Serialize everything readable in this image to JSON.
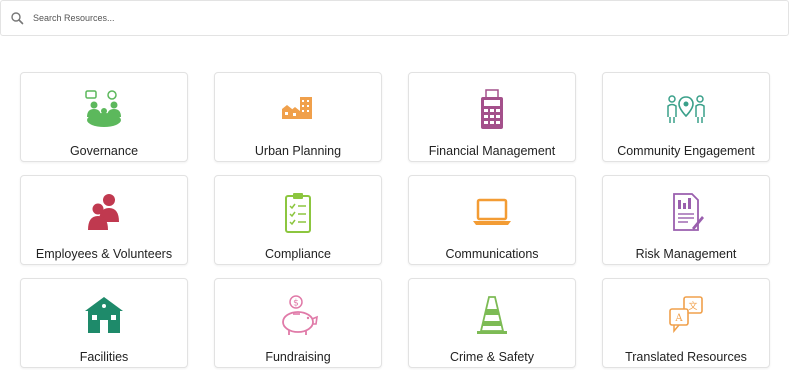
{
  "search": {
    "placeholder": "Search Resources..."
  },
  "cards": [
    {
      "label": "Governance",
      "icon": "meeting-icon",
      "color": "#5cb85c"
    },
    {
      "label": "Urban Planning",
      "icon": "city-icon",
      "color": "#f0a04b"
    },
    {
      "label": "Financial Management",
      "icon": "calculator-icon",
      "color": "#a4508b"
    },
    {
      "label": "Community Engagement",
      "icon": "people-location-icon",
      "color": "#3aa08a"
    },
    {
      "label": "Employees & Volunteers",
      "icon": "users-icon",
      "color": "#c0394f"
    },
    {
      "label": "Compliance",
      "icon": "clipboard-checklist-icon",
      "color": "#8cc63f"
    },
    {
      "label": "Communications",
      "icon": "laptop-icon",
      "color": "#f39c34"
    },
    {
      "label": "Risk Management",
      "icon": "document-chart-icon",
      "color": "#9a5fae"
    },
    {
      "label": "Facilities",
      "icon": "building-icon",
      "color": "#1e8a6a"
    },
    {
      "label": "Fundraising",
      "icon": "piggy-bank-icon",
      "color": "#e07aa8"
    },
    {
      "label": "Crime & Safety",
      "icon": "traffic-cone-icon",
      "color": "#7dbb55"
    },
    {
      "label": "Translated Resources",
      "icon": "translate-icon",
      "color": "#f0a04b"
    }
  ]
}
